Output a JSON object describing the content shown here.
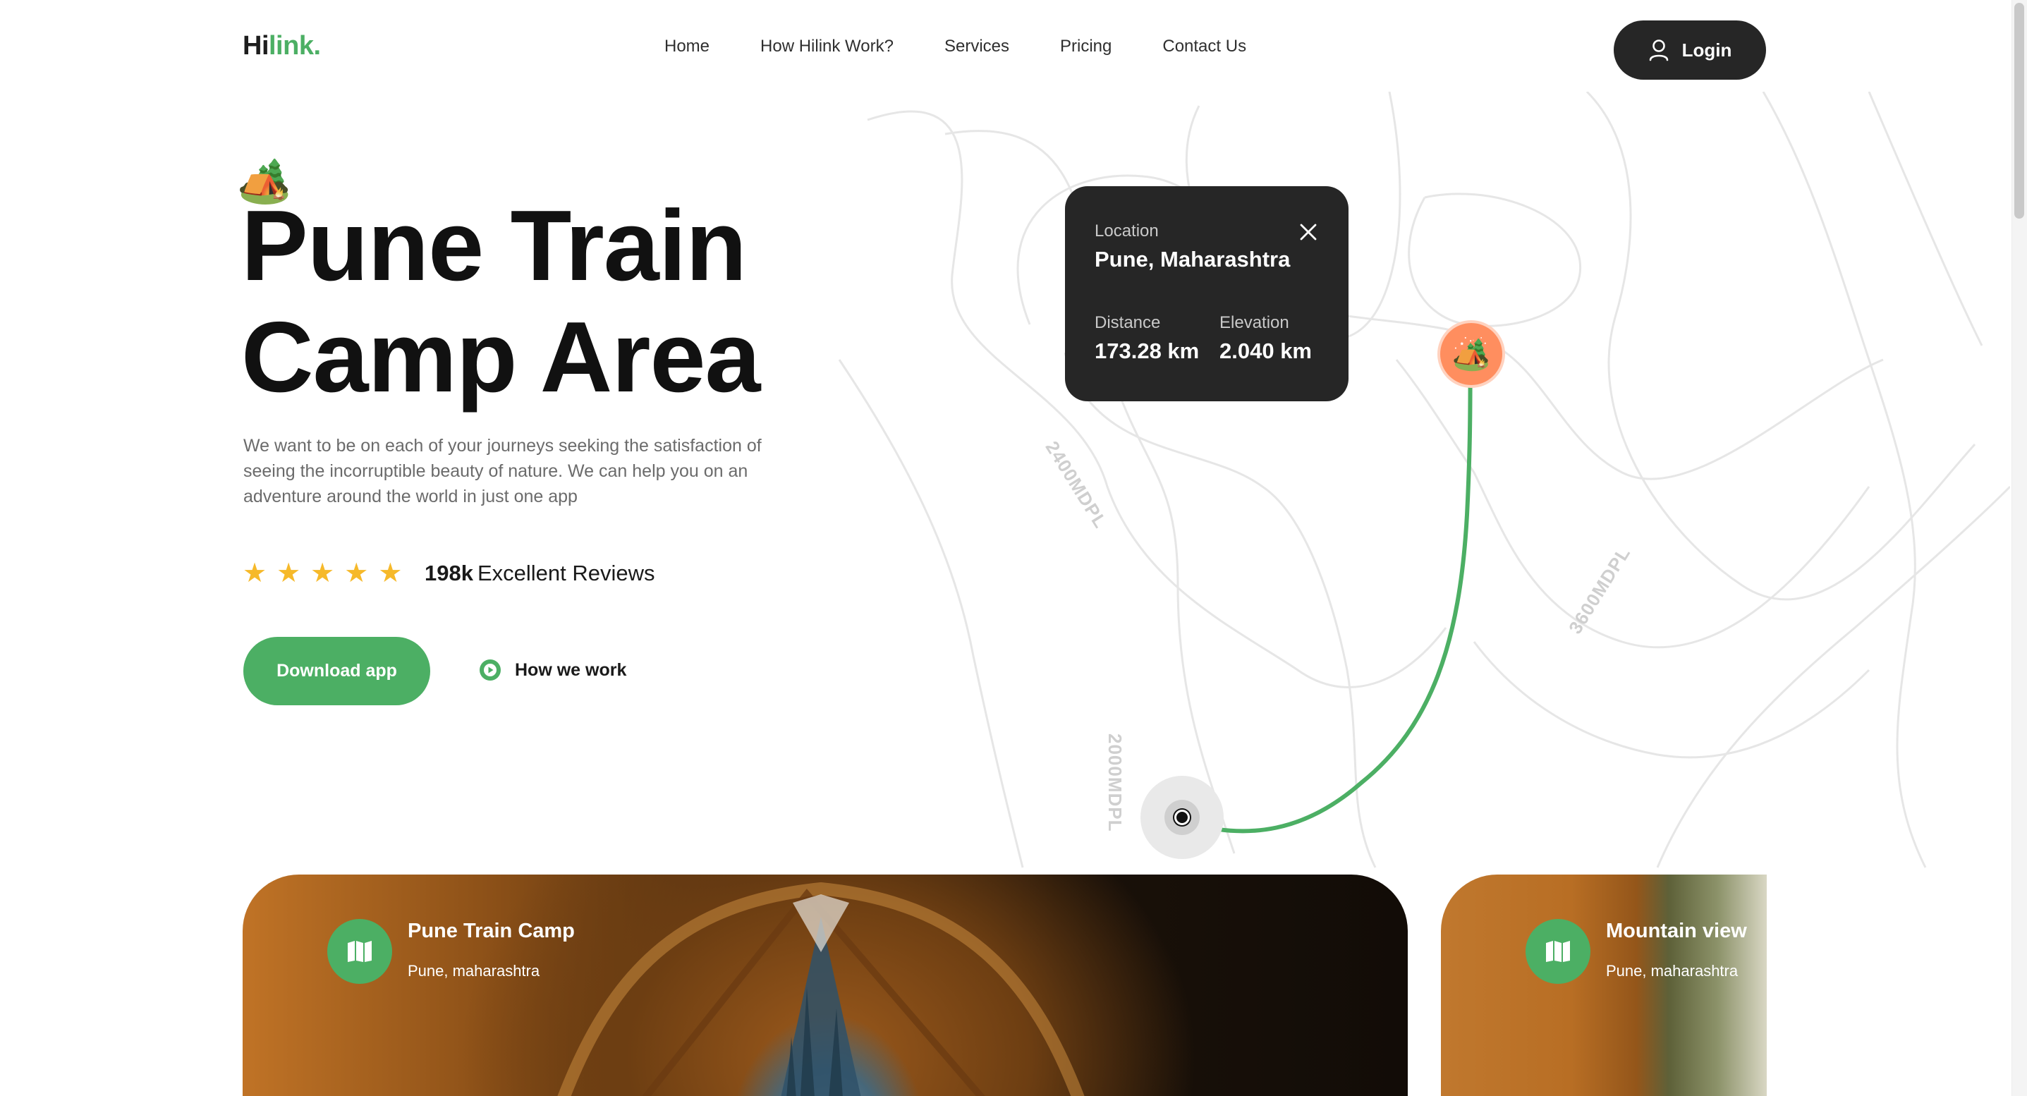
{
  "header": {
    "logo_main": "Hi",
    "logo_accent": "link.",
    "nav": [
      "Home",
      "How Hilink Work?",
      "Services",
      "Pricing",
      "Contact Us"
    ],
    "login_label": "Login"
  },
  "hero": {
    "emoji": "🏕️",
    "title_line1": "Pune Train",
    "title_line2": "Camp Area",
    "description": "We want to be on each of your journeys seeking the satisfaction of seeing the incorruptible beauty of nature. We can help you on an adventure around the world in just one app",
    "rating_stars": 5,
    "reviews_count": "198k",
    "reviews_label": "Excellent Reviews",
    "download_label": "Download app",
    "how_label": "How we work"
  },
  "map": {
    "card": {
      "location_label": "Location",
      "location_value": "Pune, Maharashtra",
      "distance_label": "Distance",
      "distance_value": "173.28 km",
      "elevation_label": "Elevation",
      "elevation_value": "2.040 km"
    },
    "contour_labels": [
      "2400MDPL",
      "3600MDPL",
      "2000MDPL"
    ],
    "pin_emoji": "🏕️",
    "route_color": "#4caf64",
    "pin_color": "#ff8e5f"
  },
  "cards": [
    {
      "title": "Pune Train Camp",
      "subtitle": "Pune, maharashtra"
    },
    {
      "title": "Mountain view",
      "subtitle": "Pune, maharashtra"
    }
  ],
  "colors": {
    "accent": "#4caf64",
    "dark": "#262626",
    "star": "#f6b92a"
  }
}
